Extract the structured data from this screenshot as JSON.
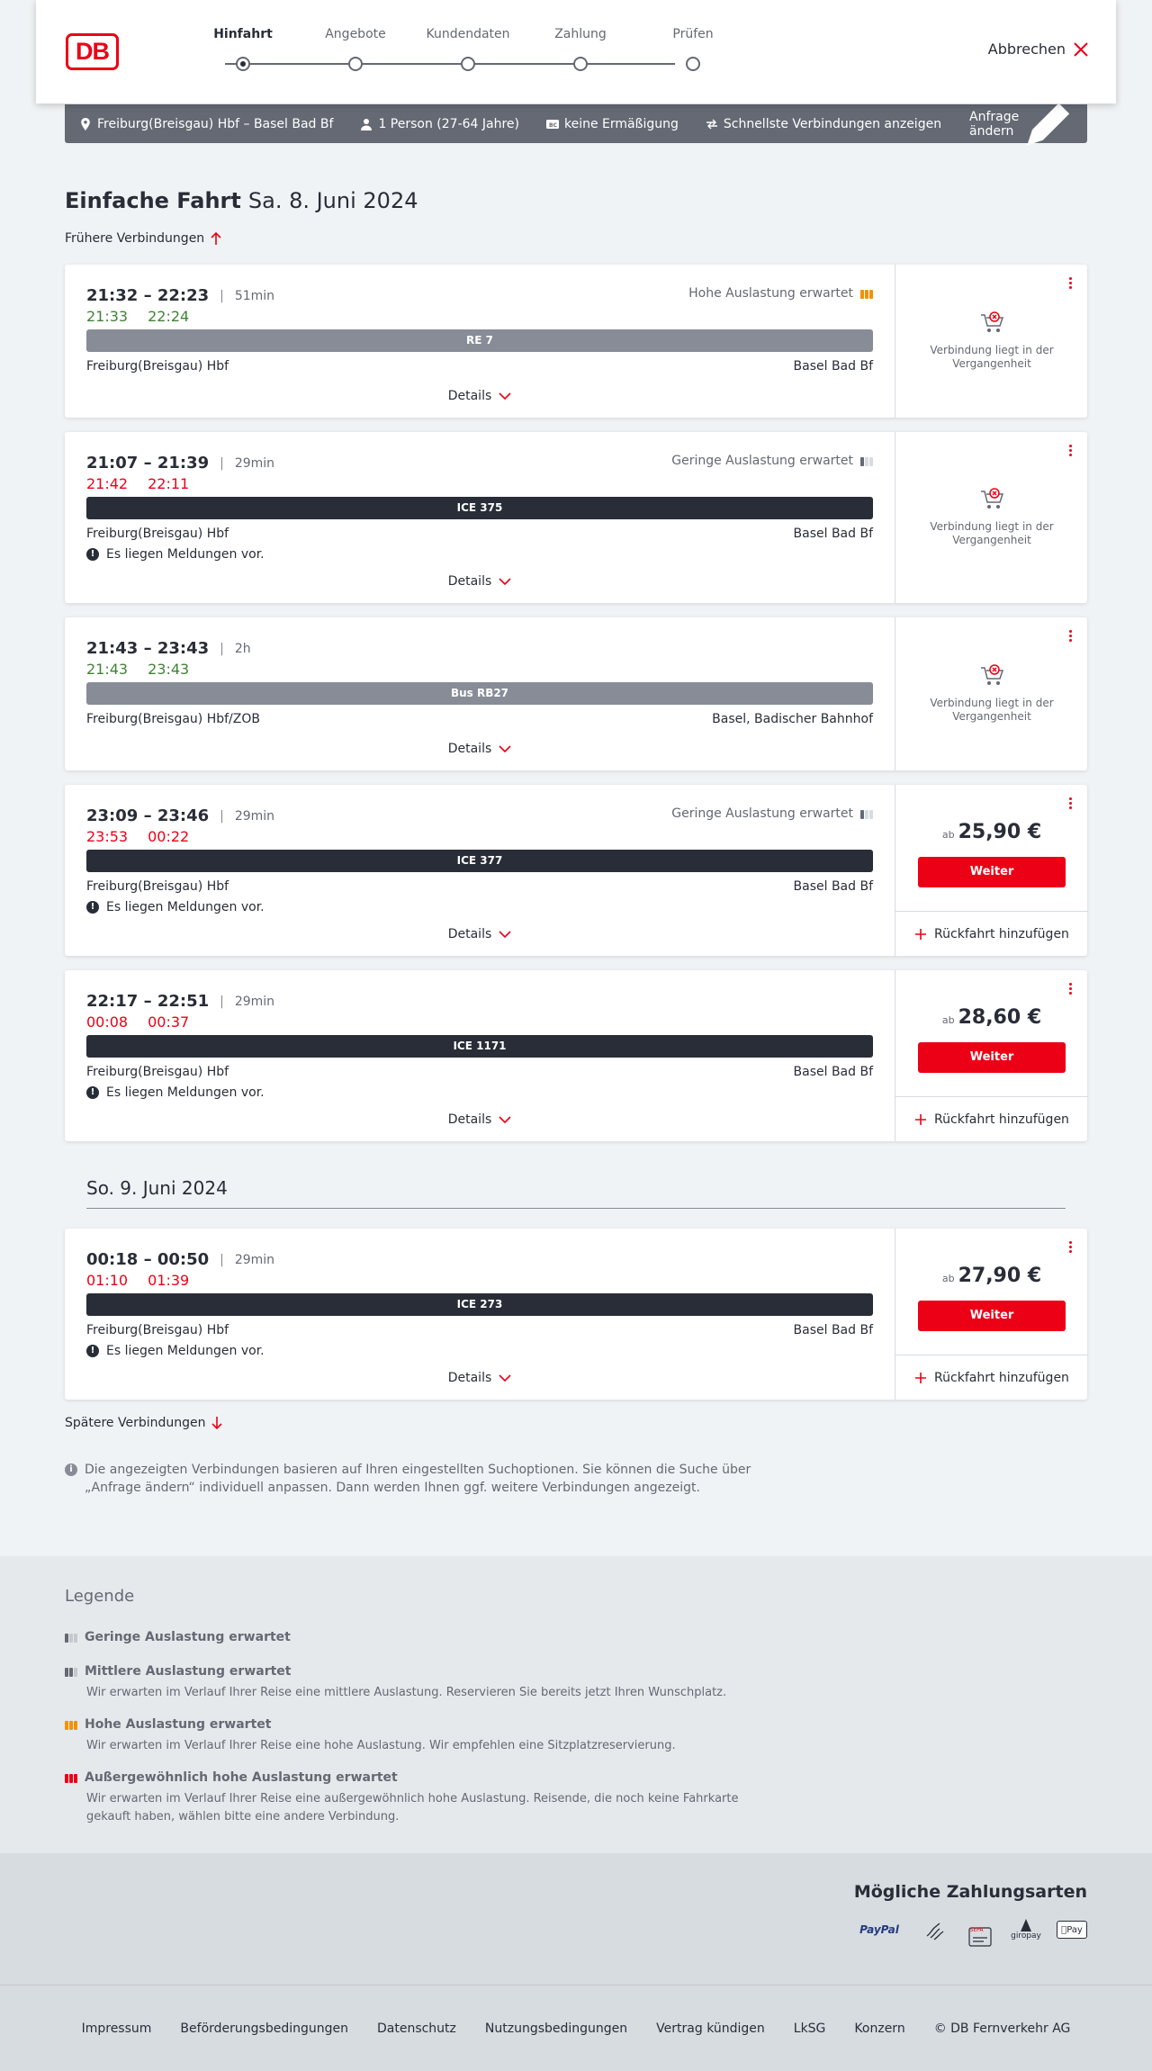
{
  "header": {
    "logo": "DB",
    "steps": [
      "Hinfahrt",
      "Angebote",
      "Kundendaten",
      "Zahlung",
      "Prüfen"
    ],
    "active_step": 0,
    "cancel_label": "Abbrechen"
  },
  "searchbar": {
    "route": "Freiburg(Breisgau) Hbf – Basel Bad Bf",
    "travellers": "1 Person (27-64 Jahre)",
    "discount": "keine Ermäßigung",
    "fastest": "Schnellste Verbindungen anzeigen",
    "change": "Anfrage ändern"
  },
  "page": {
    "title": "Einfache Fahrt",
    "date": "Sa. 8. Juni 2024",
    "earlier": "Frühere Verbindungen",
    "later": "Spätere Verbindungen",
    "next_day": "So. 9. Juni 2024",
    "info": "Die angezeigten Verbindungen basieren auf Ihren eingestellten Suchoptionen. Sie können die Suche über „Anfrage ändern“ individuell anpassen. Dann werden Ihnen ggf. weitere Verbindungen angezeigt."
  },
  "connections": [
    {
      "times": "21:32 – 22:23",
      "duration": "51min",
      "rt_dep": "21:33",
      "rt_arr": "22:24",
      "rt_status": "ok",
      "occupancy": "Hohe Auslastung erwartet",
      "occ_level": "high",
      "train": "RE 7",
      "bar": "grey",
      "from": "Freiburg(Breisgau) Hbf",
      "to": "Basel Bad Bf",
      "message": "",
      "details": "Details",
      "state": "past",
      "past_text": "Verbindung liegt in der Vergangenheit"
    },
    {
      "times": "21:07 – 21:39",
      "duration": "29min",
      "rt_dep": "21:42",
      "rt_arr": "22:11",
      "rt_status": "late",
      "occupancy": "Geringe Auslastung erwartet",
      "occ_level": "low",
      "train": "ICE 375",
      "bar": "dark",
      "from": "Freiburg(Breisgau) Hbf",
      "to": "Basel Bad Bf",
      "message": "Es liegen Meldungen vor.",
      "details": "Details",
      "state": "past",
      "past_text": "Verbindung liegt in der Vergangenheit"
    },
    {
      "times": "21:43 – 23:43",
      "duration": "2h",
      "rt_dep": "21:43",
      "rt_arr": "23:43",
      "rt_status": "ok",
      "occupancy": "",
      "occ_level": "",
      "train": "Bus RB27",
      "bar": "grey",
      "from": "Freiburg(Breisgau) Hbf/ZOB",
      "to": "Basel, Badischer Bahnhof",
      "message": "",
      "details": "Details",
      "state": "past",
      "past_text": "Verbindung liegt in der Vergangenheit"
    },
    {
      "times": "23:09 – 23:46",
      "duration": "29min",
      "rt_dep": "23:53",
      "rt_arr": "00:22",
      "rt_status": "late",
      "occupancy": "Geringe Auslastung erwartet",
      "occ_level": "low",
      "train": "ICE 377",
      "bar": "dark",
      "from": "Freiburg(Breisgau) Hbf",
      "to": "Basel Bad Bf",
      "message": "Es liegen Meldungen vor.",
      "details": "Details",
      "state": "bookable",
      "price_prefix": "ab",
      "price": "25,90 €",
      "cta": "Weiter",
      "return": "Rückfahrt hinzufügen"
    },
    {
      "times": "22:17 – 22:51",
      "duration": "29min",
      "rt_dep": "00:08",
      "rt_arr": "00:37",
      "rt_status": "late",
      "occupancy": "",
      "occ_level": "",
      "train": "ICE 1171",
      "bar": "dark",
      "from": "Freiburg(Breisgau) Hbf",
      "to": "Basel Bad Bf",
      "message": "Es liegen Meldungen vor.",
      "details": "Details",
      "state": "bookable",
      "price_prefix": "ab",
      "price": "28,60 €",
      "cta": "Weiter",
      "return": "Rückfahrt hinzufügen"
    },
    {
      "times": "00:18 – 00:50",
      "duration": "29min",
      "rt_dep": "01:10",
      "rt_arr": "01:39",
      "rt_status": "late",
      "occupancy": "",
      "occ_level": "",
      "train": "ICE 273",
      "bar": "dark",
      "from": "Freiburg(Breisgau) Hbf",
      "to": "Basel Bad Bf",
      "message": "Es liegen Meldungen vor.",
      "details": "Details",
      "state": "bookable",
      "price_prefix": "ab",
      "price": "27,90 €",
      "cta": "Weiter",
      "return": "Rückfahrt hinzufügen"
    }
  ],
  "legend": {
    "title": "Legende",
    "items": [
      {
        "title": "Geringe Auslastung erwartet",
        "text": "",
        "level": "low"
      },
      {
        "title": "Mittlere Auslastung erwartet",
        "text": "Wir erwarten im Verlauf Ihrer Reise eine mittlere Auslastung. Reservieren Sie bereits jetzt Ihren Wunschplatz.",
        "level": "medium"
      },
      {
        "title": "Hohe Auslastung erwartet",
        "text": "Wir erwarten im Verlauf Ihrer Reise eine hohe Auslastung. Wir empfehlen eine Sitzplatzreservierung.",
        "level": "high"
      },
      {
        "title": "Außergewöhnlich hohe Auslastung erwartet",
        "text": "Wir erwarten im Verlauf Ihrer Reise eine außergewöhnlich hohe Auslastung. Reisende, die noch keine Fahrkarte gekauft haben, wählen bitte eine andere Verbindung.",
        "level": "extreme"
      }
    ]
  },
  "payment": {
    "title": "Mögliche Zahlungsarten",
    "methods": [
      "PayPal",
      "SEPA",
      "giropay",
      "Pay"
    ]
  },
  "footer": {
    "links": [
      "Impressum",
      "Beförderungsbedingungen",
      "Datenschutz",
      "Nutzungsbedingungen",
      "Vertrag kündigen",
      "LkSG",
      "Konzern",
      "© DB Fernverkehr AG"
    ]
  },
  "colors": {
    "brand": "#ec0016",
    "on_time": "#408335",
    "delay": "#ec0016",
    "high_occupancy": "#f39200"
  }
}
